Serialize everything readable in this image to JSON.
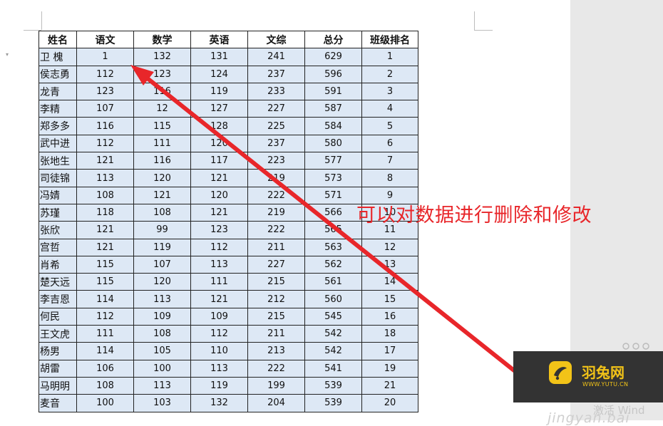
{
  "table": {
    "headers": [
      "姓名",
      "语文",
      "数学",
      "英语",
      "文综",
      "总分",
      "班级排名"
    ],
    "rows": [
      [
        "卫 槐",
        "1",
        "132",
        "131",
        "241",
        "629",
        "1"
      ],
      [
        "侯志勇",
        "112",
        "123",
        "124",
        "237",
        "596",
        "2"
      ],
      [
        "龙青",
        "123",
        "116",
        "119",
        "233",
        "591",
        "3"
      ],
      [
        "李精",
        "107",
        "12",
        "127",
        "227",
        "587",
        "4"
      ],
      [
        "郑多多",
        "116",
        "115",
        "128",
        "225",
        "584",
        "5"
      ],
      [
        "武中进",
        "112",
        "111",
        "120",
        "237",
        "580",
        "6"
      ],
      [
        "张地生",
        "121",
        "116",
        "117",
        "223",
        "577",
        "7"
      ],
      [
        "司徒锦",
        "113",
        "120",
        "121",
        "219",
        "573",
        "8"
      ],
      [
        "冯婧",
        "108",
        "121",
        "120",
        "222",
        "571",
        "9"
      ],
      [
        "苏瑾",
        "118",
        "108",
        "121",
        "219",
        "566",
        "10"
      ],
      [
        "张欣",
        "121",
        "99",
        "123",
        "222",
        "565",
        "11"
      ],
      [
        "宫哲",
        "121",
        "119",
        "112",
        "211",
        "563",
        "12"
      ],
      [
        "肖希",
        "115",
        "107",
        "113",
        "227",
        "562",
        "13"
      ],
      [
        "楚天远",
        "115",
        "120",
        "111",
        "215",
        "561",
        "14"
      ],
      [
        "李吉恩",
        "114",
        "113",
        "121",
        "212",
        "560",
        "15"
      ],
      [
        "何民",
        "112",
        "109",
        "109",
        "215",
        "545",
        "16"
      ],
      [
        "王文虎",
        "111",
        "108",
        "112",
        "211",
        "542",
        "18"
      ],
      [
        "杨男",
        "114",
        "105",
        "110",
        "213",
        "542",
        "17"
      ],
      [
        "胡雷",
        "106",
        "100",
        "113",
        "222",
        "541",
        "19"
      ],
      [
        "马明明",
        "108",
        "113",
        "119",
        "199",
        "539",
        "21"
      ],
      [
        "麦音",
        "100",
        "103",
        "132",
        "204",
        "539",
        "20"
      ]
    ]
  },
  "annotation": {
    "text": "可以对数据进行删除和修改",
    "color": "#e8262a"
  },
  "logo": {
    "name_cn": "羽兔网",
    "url": "WWW.YUTU.CN",
    "accent": "#f2c318",
    "background": "#333333"
  },
  "overlay": {
    "activate_text": "激活 Wind",
    "watermark_text": "jingyan.bai"
  },
  "icons": {
    "arrow": "red-arrow-icon",
    "logo": "yutu-logo-icon"
  }
}
